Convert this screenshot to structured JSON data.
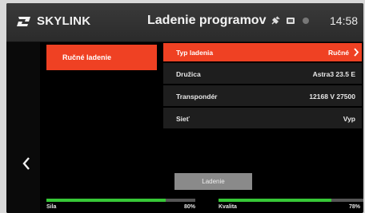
{
  "header": {
    "brand": "SKYLINK",
    "title": "Ladenie programov",
    "time": "14:58",
    "status_icons": [
      "plug-icon",
      "card-icon",
      "record-dot-icon"
    ]
  },
  "left_menu": {
    "active_item": "Ručné ladenie"
  },
  "settings": [
    {
      "label": "Typ ladenia",
      "value": "Ručné",
      "active": true
    },
    {
      "label": "Družica",
      "value": "Astra3 23.5 E",
      "active": false
    },
    {
      "label": "Transpondér",
      "value": "12168 V 27500",
      "active": false
    },
    {
      "label": "Sieť",
      "value": "Vyp",
      "active": false
    }
  ],
  "scan_button": {
    "label": "Ladenie"
  },
  "signal": {
    "strength_label": "Sila",
    "strength_value": "80%",
    "strength_fraction": 0.8,
    "quality_label": "Kvalita",
    "quality_value": "78%",
    "quality_fraction": 0.78
  },
  "colors": {
    "accent": "#ef4123",
    "bar_fill": "#37c837"
  }
}
